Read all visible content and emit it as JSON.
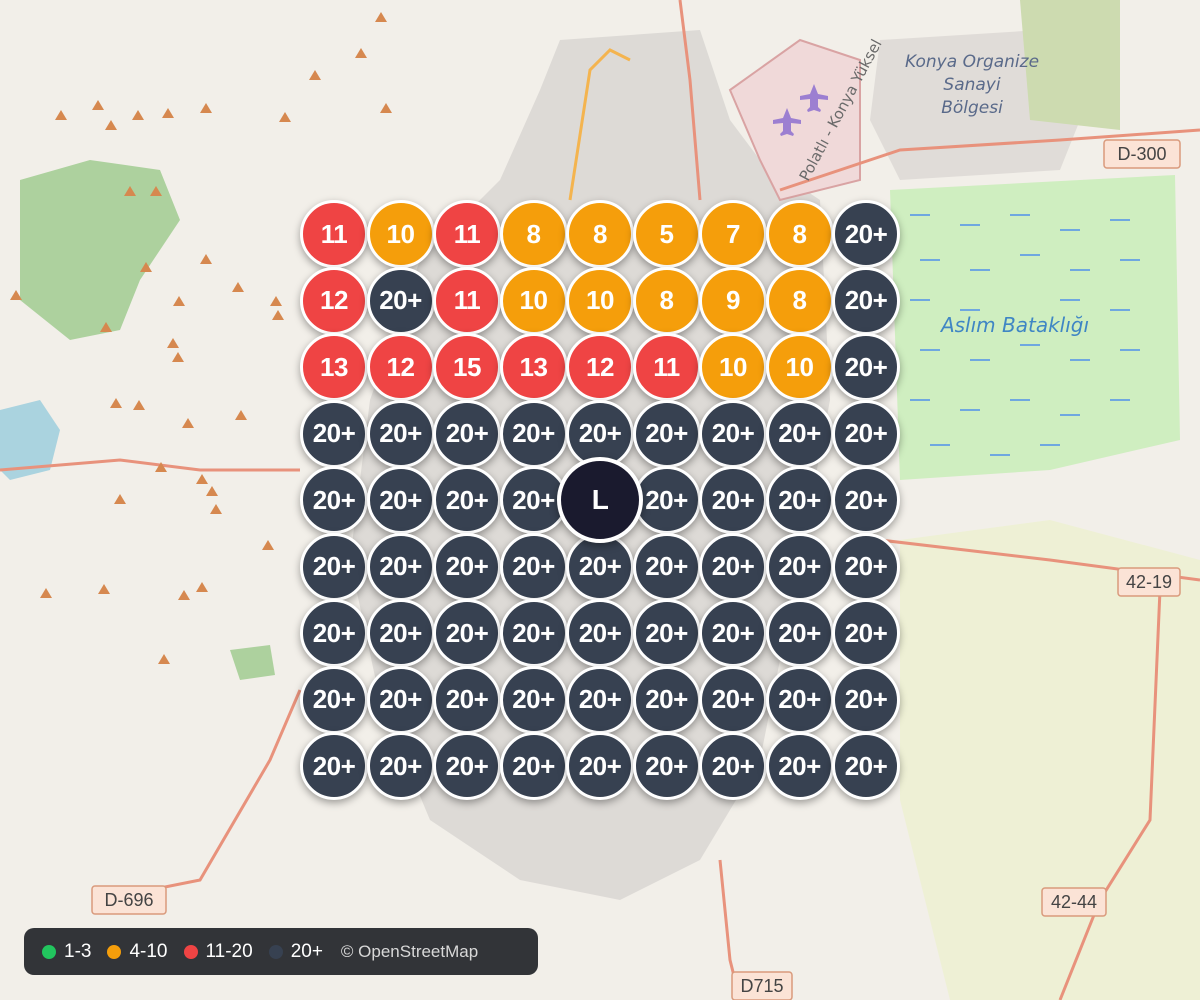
{
  "map": {
    "labels": {
      "industrial_zone": [
        "Konya Organize",
        "Sanayi",
        "Bölgesi"
      ],
      "marsh": "Aslım Bataklığı",
      "highway": "Polatlı - Konya Yüksel"
    },
    "road_shields": [
      "D-300",
      "42-19",
      "42-44",
      "D-696",
      "D715"
    ]
  },
  "colors": {
    "low": "#22c55e",
    "medium": "#f59e0b",
    "high": "#ef4444",
    "very_high": "#374151",
    "center": "#1a1a2e"
  },
  "grid": {
    "center_label": "L",
    "rows": [
      [
        "11",
        "10",
        "11",
        "8",
        "8",
        "5",
        "7",
        "8",
        "20+"
      ],
      [
        "12",
        "20+",
        "11",
        "10",
        "10",
        "8",
        "9",
        "8",
        "20+"
      ],
      [
        "13",
        "12",
        "15",
        "13",
        "12",
        "11",
        "10",
        "10",
        "20+"
      ],
      [
        "20+",
        "20+",
        "20+",
        "20+",
        "20+",
        "20+",
        "20+",
        "20+",
        "20+"
      ],
      [
        "20+",
        "20+",
        "20+",
        "20+",
        "L",
        "20+",
        "20+",
        "20+",
        "20+"
      ],
      [
        "20+",
        "20+",
        "20+",
        "20+",
        "20+",
        "20+",
        "20+",
        "20+",
        "20+"
      ],
      [
        "20+",
        "20+",
        "20+",
        "20+",
        "20+",
        "20+",
        "20+",
        "20+",
        "20+"
      ],
      [
        "20+",
        "20+",
        "20+",
        "20+",
        "20+",
        "20+",
        "20+",
        "20+",
        "20+"
      ],
      [
        "20+",
        "20+",
        "20+",
        "20+",
        "20+",
        "20+",
        "20+",
        "20+",
        "20+"
      ]
    ]
  },
  "legend": {
    "items": [
      {
        "label": "1-3",
        "color": "#22c55e"
      },
      {
        "label": "4-10",
        "color": "#f59e0b"
      },
      {
        "label": "11-20",
        "color": "#ef4444"
      },
      {
        "label": "20+",
        "color": "#374151"
      }
    ],
    "attribution": "© OpenStreetMap"
  }
}
